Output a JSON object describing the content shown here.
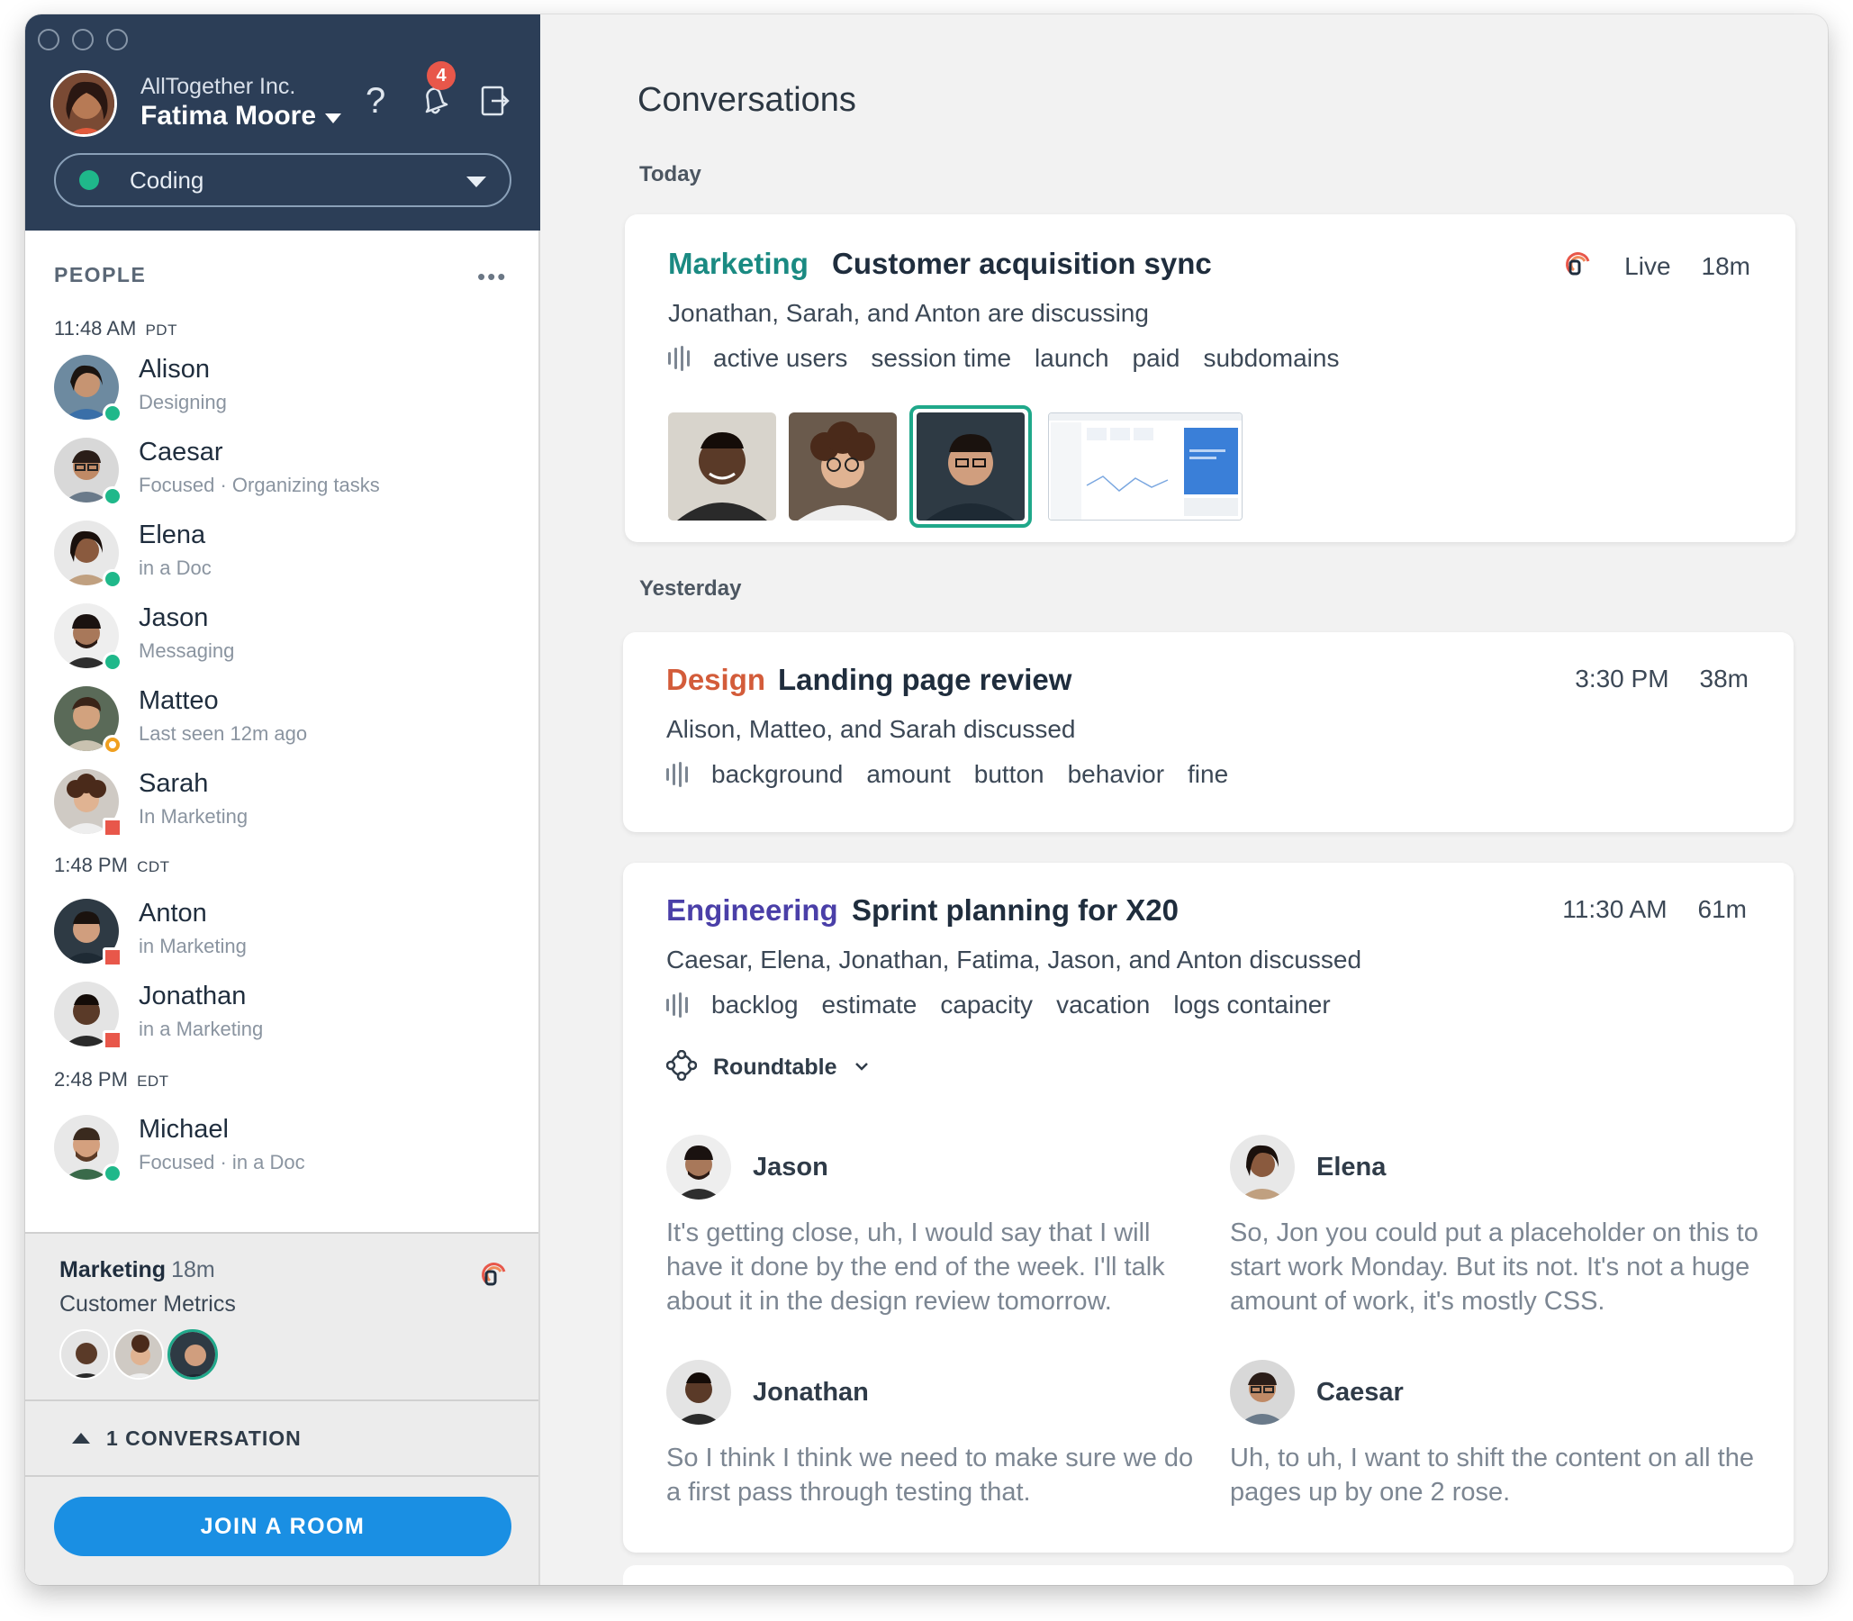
{
  "header": {
    "org": "AllTogether Inc.",
    "user_name": "Fatima Moore",
    "notification_count": "4",
    "help_glyph": "?",
    "status": "Coding"
  },
  "people": {
    "title": "PEOPLE",
    "more": "•••",
    "groups": [
      {
        "time": "11:48 AM",
        "zone": "PDT"
      },
      {
        "time": "1:48 PM",
        "zone": "CDT"
      },
      {
        "time": "2:48 PM",
        "zone": "EDT"
      }
    ],
    "list": [
      {
        "name": "Alison",
        "status": "Designing",
        "presence": "green"
      },
      {
        "name": "Caesar",
        "status": "Focused · Organizing tasks",
        "presence": "green-focus"
      },
      {
        "name": "Elena",
        "status": "in a Doc",
        "presence": "green"
      },
      {
        "name": "Jason",
        "status": "Messaging",
        "presence": "green"
      },
      {
        "name": "Matteo",
        "status": "Last seen 12m ago",
        "presence": "away"
      },
      {
        "name": "Sarah",
        "status": "In Marketing",
        "presence": "busy"
      },
      {
        "name": "Anton",
        "status": "in Marketing",
        "presence": "busy"
      },
      {
        "name": "Jonathan",
        "status": "in a Marketing",
        "presence": "busy"
      },
      {
        "name": "Michael",
        "status": "Focused · in a Doc",
        "presence": "green-focus"
      }
    ]
  },
  "active_conversation": {
    "team": "Marketing",
    "duration": "18m",
    "subtitle": "Customer Metrics",
    "icon": "live-icon"
  },
  "conversation_count": "1 CONVERSATION",
  "join_button": "JOIN A ROOM",
  "main": {
    "title": "Conversations",
    "today_label": "Today",
    "yesterday_label": "Yesterday",
    "cards": [
      {
        "team": "Marketing",
        "team_color": "#1a8a82",
        "title": "Customer acquisition sync",
        "status": "Live",
        "duration": "18m",
        "participants": "Jonathan, Sarah, and Anton are discussing",
        "keywords": [
          "active users",
          "session time",
          "launch",
          "paid",
          "subdomains"
        ]
      },
      {
        "team": "Design",
        "team_color": "#d35c3a",
        "title": "Landing page review",
        "time": "3:30 PM",
        "duration": "38m",
        "participants": "Alison, Matteo, and Sarah discussed",
        "keywords": [
          "background",
          "amount",
          "button",
          "behavior",
          "fine"
        ]
      },
      {
        "team": "Engineering",
        "team_color": "#4a3fa8",
        "title": "Sprint planning for X20",
        "time": "11:30 AM",
        "duration": "61m",
        "participants": "Caesar, Elena, Jonathan, Fatima, Jason, and Anton discussed",
        "keywords": [
          "backlog",
          "estimate",
          "capacity",
          "vacation",
          "logs container"
        ],
        "roundtable_label": "Roundtable",
        "quotes": [
          {
            "name": "Jason",
            "text": "It's getting close, uh, I would say that I will have it done by the end of the week.  I'll talk about it in the design review tomorrow."
          },
          {
            "name": "Elena",
            "text": "So, Jon you could put a placeholder on this to start work Monday.  But its not. It's not a huge amount of work, it's mostly CSS."
          },
          {
            "name": "Jonathan",
            "text": "So I think I think we need to make sure we do a first pass through testing that."
          },
          {
            "name": "Caesar",
            "text": "Uh, to uh, I want to shift the content on all the pages up by one 2 rose."
          }
        ]
      }
    ]
  }
}
